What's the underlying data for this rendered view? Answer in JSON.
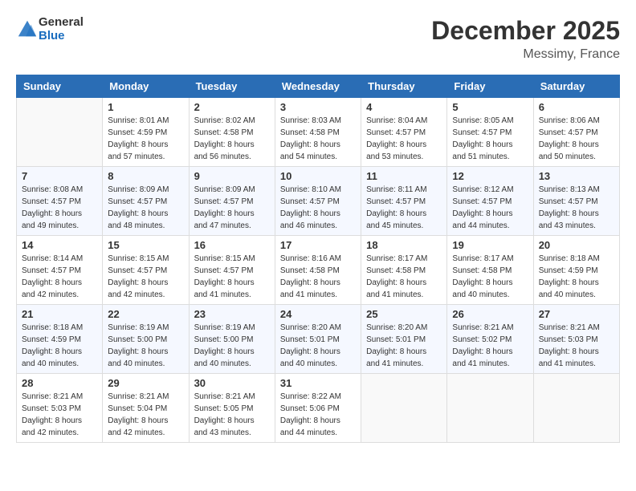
{
  "header": {
    "logo_general": "General",
    "logo_blue": "Blue",
    "month": "December 2025",
    "location": "Messimy, France"
  },
  "days_of_week": [
    "Sunday",
    "Monday",
    "Tuesday",
    "Wednesday",
    "Thursday",
    "Friday",
    "Saturday"
  ],
  "weeks": [
    [
      {
        "day": "",
        "sunrise": "",
        "sunset": "",
        "daylight": ""
      },
      {
        "day": "1",
        "sunrise": "Sunrise: 8:01 AM",
        "sunset": "Sunset: 4:59 PM",
        "daylight": "Daylight: 8 hours and 57 minutes."
      },
      {
        "day": "2",
        "sunrise": "Sunrise: 8:02 AM",
        "sunset": "Sunset: 4:58 PM",
        "daylight": "Daylight: 8 hours and 56 minutes."
      },
      {
        "day": "3",
        "sunrise": "Sunrise: 8:03 AM",
        "sunset": "Sunset: 4:58 PM",
        "daylight": "Daylight: 8 hours and 54 minutes."
      },
      {
        "day": "4",
        "sunrise": "Sunrise: 8:04 AM",
        "sunset": "Sunset: 4:57 PM",
        "daylight": "Daylight: 8 hours and 53 minutes."
      },
      {
        "day": "5",
        "sunrise": "Sunrise: 8:05 AM",
        "sunset": "Sunset: 4:57 PM",
        "daylight": "Daylight: 8 hours and 51 minutes."
      },
      {
        "day": "6",
        "sunrise": "Sunrise: 8:06 AM",
        "sunset": "Sunset: 4:57 PM",
        "daylight": "Daylight: 8 hours and 50 minutes."
      }
    ],
    [
      {
        "day": "7",
        "sunrise": "Sunrise: 8:08 AM",
        "sunset": "Sunset: 4:57 PM",
        "daylight": "Daylight: 8 hours and 49 minutes."
      },
      {
        "day": "8",
        "sunrise": "Sunrise: 8:09 AM",
        "sunset": "Sunset: 4:57 PM",
        "daylight": "Daylight: 8 hours and 48 minutes."
      },
      {
        "day": "9",
        "sunrise": "Sunrise: 8:09 AM",
        "sunset": "Sunset: 4:57 PM",
        "daylight": "Daylight: 8 hours and 47 minutes."
      },
      {
        "day": "10",
        "sunrise": "Sunrise: 8:10 AM",
        "sunset": "Sunset: 4:57 PM",
        "daylight": "Daylight: 8 hours and 46 minutes."
      },
      {
        "day": "11",
        "sunrise": "Sunrise: 8:11 AM",
        "sunset": "Sunset: 4:57 PM",
        "daylight": "Daylight: 8 hours and 45 minutes."
      },
      {
        "day": "12",
        "sunrise": "Sunrise: 8:12 AM",
        "sunset": "Sunset: 4:57 PM",
        "daylight": "Daylight: 8 hours and 44 minutes."
      },
      {
        "day": "13",
        "sunrise": "Sunrise: 8:13 AM",
        "sunset": "Sunset: 4:57 PM",
        "daylight": "Daylight: 8 hours and 43 minutes."
      }
    ],
    [
      {
        "day": "14",
        "sunrise": "Sunrise: 8:14 AM",
        "sunset": "Sunset: 4:57 PM",
        "daylight": "Daylight: 8 hours and 42 minutes."
      },
      {
        "day": "15",
        "sunrise": "Sunrise: 8:15 AM",
        "sunset": "Sunset: 4:57 PM",
        "daylight": "Daylight: 8 hours and 42 minutes."
      },
      {
        "day": "16",
        "sunrise": "Sunrise: 8:15 AM",
        "sunset": "Sunset: 4:57 PM",
        "daylight": "Daylight: 8 hours and 41 minutes."
      },
      {
        "day": "17",
        "sunrise": "Sunrise: 8:16 AM",
        "sunset": "Sunset: 4:58 PM",
        "daylight": "Daylight: 8 hours and 41 minutes."
      },
      {
        "day": "18",
        "sunrise": "Sunrise: 8:17 AM",
        "sunset": "Sunset: 4:58 PM",
        "daylight": "Daylight: 8 hours and 41 minutes."
      },
      {
        "day": "19",
        "sunrise": "Sunrise: 8:17 AM",
        "sunset": "Sunset: 4:58 PM",
        "daylight": "Daylight: 8 hours and 40 minutes."
      },
      {
        "day": "20",
        "sunrise": "Sunrise: 8:18 AM",
        "sunset": "Sunset: 4:59 PM",
        "daylight": "Daylight: 8 hours and 40 minutes."
      }
    ],
    [
      {
        "day": "21",
        "sunrise": "Sunrise: 8:18 AM",
        "sunset": "Sunset: 4:59 PM",
        "daylight": "Daylight: 8 hours and 40 minutes."
      },
      {
        "day": "22",
        "sunrise": "Sunrise: 8:19 AM",
        "sunset": "Sunset: 5:00 PM",
        "daylight": "Daylight: 8 hours and 40 minutes."
      },
      {
        "day": "23",
        "sunrise": "Sunrise: 8:19 AM",
        "sunset": "Sunset: 5:00 PM",
        "daylight": "Daylight: 8 hours and 40 minutes."
      },
      {
        "day": "24",
        "sunrise": "Sunrise: 8:20 AM",
        "sunset": "Sunset: 5:01 PM",
        "daylight": "Daylight: 8 hours and 40 minutes."
      },
      {
        "day": "25",
        "sunrise": "Sunrise: 8:20 AM",
        "sunset": "Sunset: 5:01 PM",
        "daylight": "Daylight: 8 hours and 41 minutes."
      },
      {
        "day": "26",
        "sunrise": "Sunrise: 8:21 AM",
        "sunset": "Sunset: 5:02 PM",
        "daylight": "Daylight: 8 hours and 41 minutes."
      },
      {
        "day": "27",
        "sunrise": "Sunrise: 8:21 AM",
        "sunset": "Sunset: 5:03 PM",
        "daylight": "Daylight: 8 hours and 41 minutes."
      }
    ],
    [
      {
        "day": "28",
        "sunrise": "Sunrise: 8:21 AM",
        "sunset": "Sunset: 5:03 PM",
        "daylight": "Daylight: 8 hours and 42 minutes."
      },
      {
        "day": "29",
        "sunrise": "Sunrise: 8:21 AM",
        "sunset": "Sunset: 5:04 PM",
        "daylight": "Daylight: 8 hours and 42 minutes."
      },
      {
        "day": "30",
        "sunrise": "Sunrise: 8:21 AM",
        "sunset": "Sunset: 5:05 PM",
        "daylight": "Daylight: 8 hours and 43 minutes."
      },
      {
        "day": "31",
        "sunrise": "Sunrise: 8:22 AM",
        "sunset": "Sunset: 5:06 PM",
        "daylight": "Daylight: 8 hours and 44 minutes."
      },
      {
        "day": "",
        "sunrise": "",
        "sunset": "",
        "daylight": ""
      },
      {
        "day": "",
        "sunrise": "",
        "sunset": "",
        "daylight": ""
      },
      {
        "day": "",
        "sunrise": "",
        "sunset": "",
        "daylight": ""
      }
    ]
  ]
}
